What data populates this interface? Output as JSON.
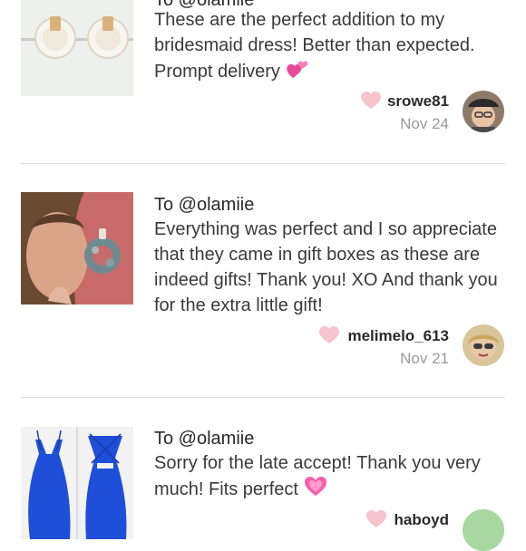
{
  "reviews": [
    {
      "to": "To @olamiie",
      "text": "These are the perfect addition to my bridesmaid dress! Better than expected. Prompt delivery",
      "emoji": "two-hearts",
      "author": "srowe81",
      "date": "Nov 24",
      "thumb": "white-shell-earrings",
      "avatar": "woman-with-cap-and-glasses"
    },
    {
      "to": "To @olamiie",
      "text": "Everything was perfect and I so appreciate that they came in gift boxes as these are indeed gifts! Thank you! XO And thank you for the extra little gift!",
      "author": "melimelo_613",
      "date": "Nov 21",
      "thumb": "model-wearing-abalone-earrings",
      "avatar": "woman-with-sunglasses"
    },
    {
      "to": "To @olamiie",
      "text": "Sorry for the late accept! Thank you very much! Fits perfect",
      "emoji": "sparkling-heart",
      "author": "haboyd",
      "thumb": "blue-dress-front-and-back",
      "avatar": "initials-avatar"
    }
  ],
  "colors": {
    "heart": "#f7c3cc",
    "divider": "#dddddd",
    "date": "#9a9a9a",
    "avatar_green": "#a7d8a0"
  }
}
